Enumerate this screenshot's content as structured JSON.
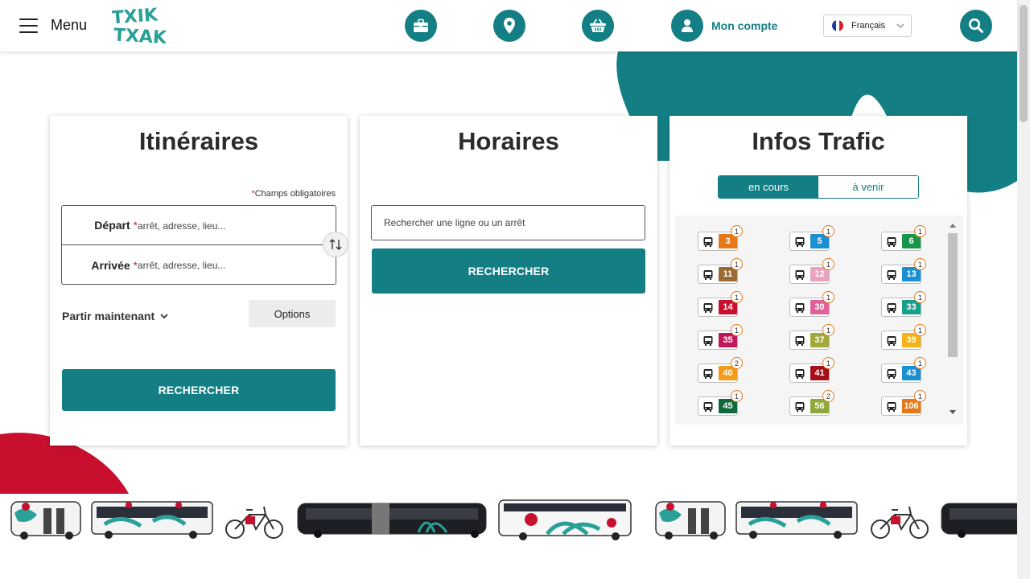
{
  "header": {
    "menu_label": "Menu",
    "logo_text": "TXIK TXAK",
    "account_label": "Mon compte",
    "language": "Français"
  },
  "itineraries": {
    "title": "Itinéraires",
    "required_note": "Champs obligatoires",
    "required_marker": "*",
    "departure_label": "Départ",
    "departure_placeholder": "arrêt, adresse, lieu...",
    "arrival_label": "Arrivée",
    "arrival_placeholder": "arrêt, adresse, lieu...",
    "depart_now": "Partir maintenant",
    "options": "Options",
    "search": "RECHERCHER"
  },
  "schedules": {
    "title": "Horaires",
    "search_placeholder": "Rechercher une ligne ou un arrêt",
    "search": "RECHERCHER"
  },
  "traffic": {
    "title": "Infos Trafic",
    "tab_current": "en cours",
    "tab_upcoming": "à venir",
    "lines": [
      {
        "number": "3",
        "count": "1",
        "color": "#e77817"
      },
      {
        "number": "5",
        "count": "1",
        "color": "#1a8fd1"
      },
      {
        "number": "6",
        "count": "1",
        "color": "#17964a"
      },
      {
        "number": "11",
        "count": "1",
        "color": "#9a6a35"
      },
      {
        "number": "12",
        "count": "1",
        "color": "#e8a3c0"
      },
      {
        "number": "13",
        "count": "1",
        "color": "#1a8fd1"
      },
      {
        "number": "14",
        "count": "1",
        "color": "#c8102e"
      },
      {
        "number": "30",
        "count": "1",
        "color": "#e0609a"
      },
      {
        "number": "33",
        "count": "1",
        "color": "#15a08c"
      },
      {
        "number": "35",
        "count": "1",
        "color": "#c2185b"
      },
      {
        "number": "37",
        "count": "1",
        "color": "#a2a83a"
      },
      {
        "number": "39",
        "count": "1",
        "color": "#f5b21b"
      },
      {
        "number": "40",
        "count": "2",
        "color": "#f29b1c"
      },
      {
        "number": "41",
        "count": "1",
        "color": "#a50e1a"
      },
      {
        "number": "43",
        "count": "1",
        "color": "#1a8fd1"
      },
      {
        "number": "45",
        "count": "1",
        "color": "#10683c"
      },
      {
        "number": "56",
        "count": "2",
        "color": "#8fa83a"
      },
      {
        "number": "106",
        "count": "1",
        "color": "#e77817"
      }
    ]
  },
  "colors": {
    "brand": "#137f85",
    "accent_red": "#c8102e"
  }
}
